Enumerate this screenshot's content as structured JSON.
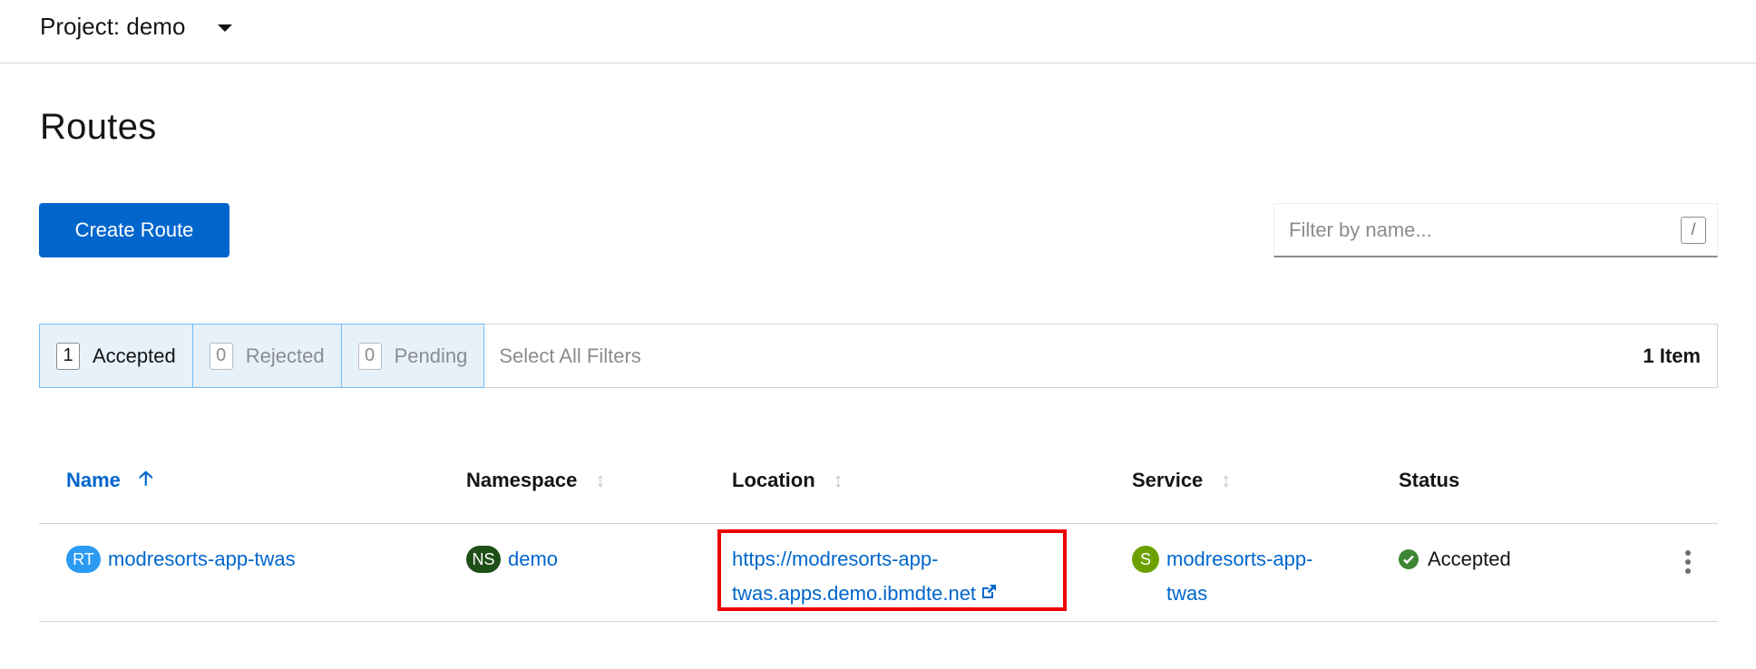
{
  "project_bar": {
    "label": "Project: demo"
  },
  "page": {
    "title": "Routes"
  },
  "toolbar": {
    "create_label": "Create Route",
    "filter_placeholder": "Filter by name...",
    "filter_shortcut": "/"
  },
  "row_filters": {
    "chips": [
      {
        "count": "1",
        "label": "Accepted"
      },
      {
        "count": "0",
        "label": "Rejected"
      },
      {
        "count": "0",
        "label": "Pending"
      }
    ],
    "select_all": "Select All Filters",
    "item_count": "1 Item"
  },
  "table": {
    "columns": [
      {
        "label": "Name",
        "sort_icon": "arrow-up-icon"
      },
      {
        "label": "Namespace",
        "sort_icon": "sort-icon"
      },
      {
        "label": "Location",
        "sort_icon": "sort-icon"
      },
      {
        "label": "Service",
        "sort_icon": "sort-icon"
      },
      {
        "label": "Status"
      }
    ],
    "rows": [
      {
        "name_badge": "RT",
        "name": "modresorts-app-twas",
        "namespace_badge": "NS",
        "namespace": "demo",
        "location_line1": "https://modresorts-app-",
        "location_line2": "twas.apps.demo.ibmdte.net",
        "service_badge": "S",
        "service_line1": "modresorts-app-",
        "service_line2": "twas",
        "status": "Accepted"
      }
    ]
  },
  "colors": {
    "primary": "#0066cc",
    "highlight_box": "#ee0000",
    "accepted": "#3e8635",
    "badge_rt": "#2b9af3",
    "badge_ns": "#1e4f18",
    "badge_s": "#6ca100"
  }
}
